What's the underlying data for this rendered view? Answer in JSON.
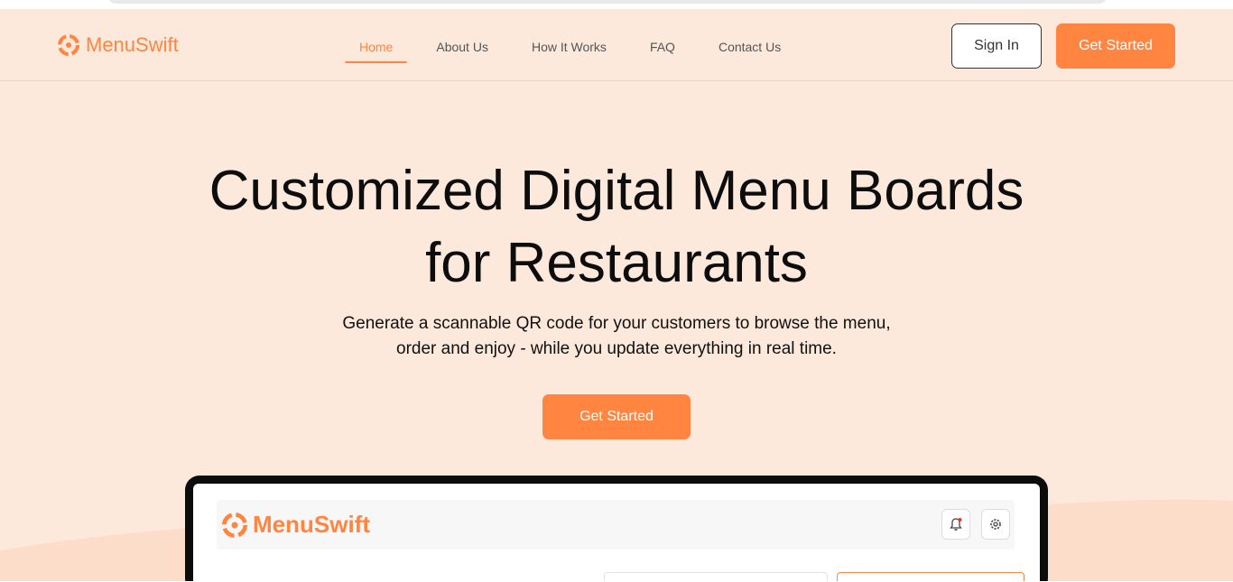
{
  "brand": {
    "name": "MenuSwift",
    "accent": "#ff8540",
    "background": "#fde8dc"
  },
  "nav": {
    "items": [
      {
        "label": "Home",
        "active": true
      },
      {
        "label": "About Us",
        "active": false
      },
      {
        "label": "How It Works",
        "active": false
      },
      {
        "label": "FAQ",
        "active": false
      },
      {
        "label": "Contact Us",
        "active": false
      }
    ]
  },
  "header": {
    "signin_label": "Sign In",
    "get_started_label": "Get Started"
  },
  "hero": {
    "title_line1": "Customized Digital Menu Boards",
    "title_line2": "for Restaurants",
    "subtitle_line1": "Generate a scannable QR code for your customers to browse the menu,",
    "subtitle_line2": "order and enjoy - while you update everything in real time.",
    "cta_label": "Get Started"
  },
  "preview": {
    "app_name": "MenuSwift",
    "icons": [
      "bell-icon",
      "gear-icon"
    ]
  }
}
